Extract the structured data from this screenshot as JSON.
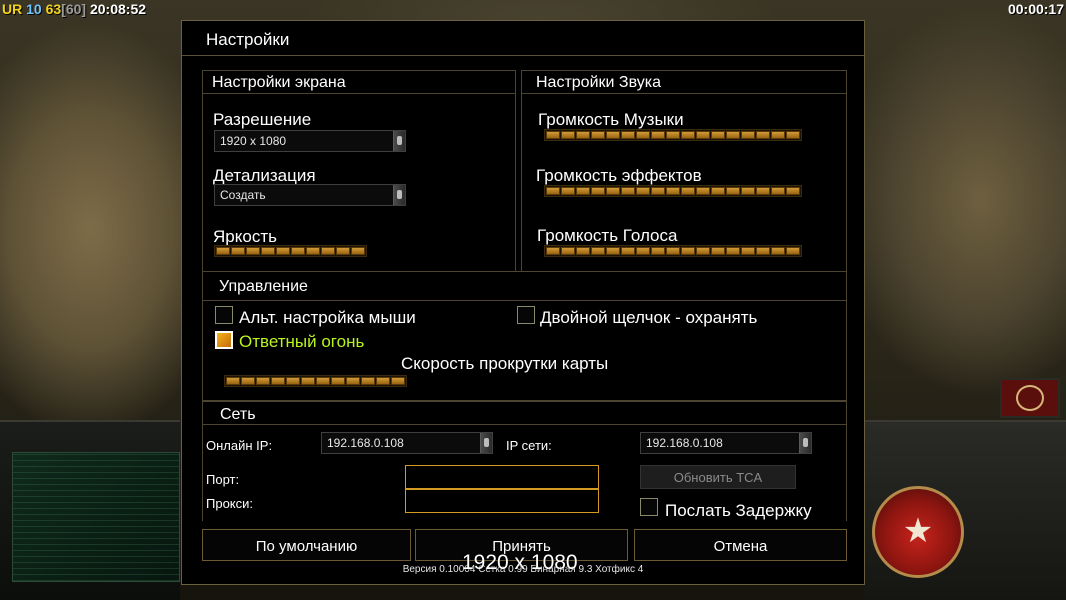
{
  "status": {
    "ur": "UR",
    "n1": "10",
    "n2": "63",
    "n3": "[60]",
    "clock": "20:08:52",
    "timer": "00:00:17"
  },
  "dialog": {
    "title": "Настройки",
    "display": {
      "title": "Настройки экрана",
      "resolution_label": "Разрешение",
      "resolution_value": "1920 x 1080",
      "detail_label": "Детализация",
      "detail_value": "Создать",
      "brightness_label": "Яркость",
      "brightness_level": 1.0
    },
    "sound": {
      "title": "Настройки Звука",
      "music_label": "Громкость Музыки",
      "effects_label": "Громкость эффектов",
      "voice_label": "Громкость Голоса",
      "music_level": 1.0,
      "effects_level": 1.0,
      "voice_level": 1.0
    },
    "controls": {
      "title": "Управление",
      "alt_mouse_label": "Альт. настройка мыши",
      "alt_mouse_checked": false,
      "double_click_label": "Двойной щелчок - охранять",
      "double_click_checked": false,
      "return_fire_label": "Ответный огонь",
      "return_fire_checked": true,
      "scroll_speed_label": "Скорость прокрутки карты",
      "scroll_speed_level": 1.0
    },
    "network": {
      "title": "Сеть",
      "online_ip_label": "Онлайн IP:",
      "online_ip_value": "192.168.0.108",
      "lan_ip_label": "IP сети:",
      "lan_ip_value": "192.168.0.108",
      "port_label": "Порт:",
      "proxy_label": "Прокси:",
      "update_tca_label": "Обновить TCA",
      "send_delay_label": "Послать Задержку",
      "send_delay_checked": false
    },
    "buttons": {
      "default": "По умолчанию",
      "accept": "Принять",
      "cancel": "Отмена"
    },
    "version": "Версия 0.10004 Сетка 0.99 Бинарная 9.3 Хотфикс 4",
    "resolution_overlay": "1920 x 1080"
  },
  "colors": {
    "accent": "#d49a22",
    "check_green": "#b8f51c",
    "panel_border": "#4b4430"
  }
}
